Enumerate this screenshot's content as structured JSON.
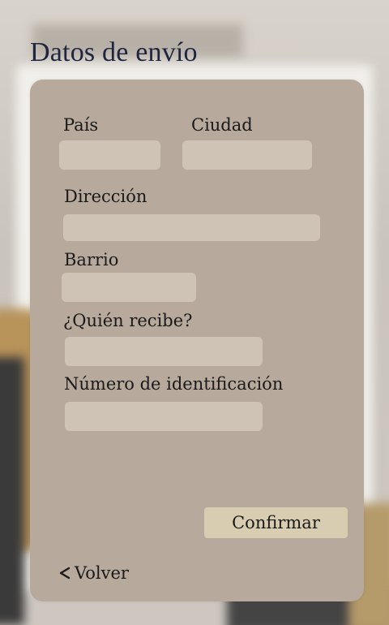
{
  "page": {
    "title": "Datos de envío"
  },
  "form": {
    "country": {
      "label": "País",
      "value": ""
    },
    "city": {
      "label": "Ciudad",
      "value": ""
    },
    "address": {
      "label": "Dirección",
      "value": ""
    },
    "neighborhood": {
      "label": "Barrio",
      "value": ""
    },
    "recipient": {
      "label": "¿Quién recibe?",
      "value": ""
    },
    "id_number": {
      "label": "Número de identificación",
      "value": ""
    }
  },
  "actions": {
    "confirm_label": "Confirmar",
    "back_label": "Volver",
    "back_icon": "chevron-left-icon"
  },
  "colors": {
    "card": "#b7aa9d",
    "input": "#cfc3b6",
    "confirm": "#d8cdb0",
    "title": "#1f2541"
  }
}
